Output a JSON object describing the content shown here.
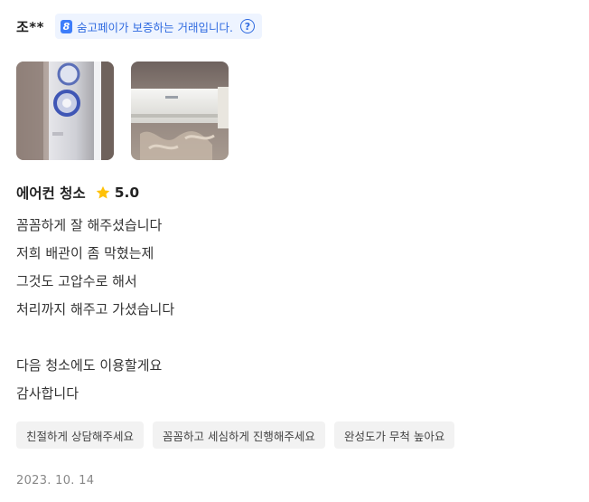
{
  "reviewer": {
    "name": "조**"
  },
  "pay_badge": {
    "logo": "8",
    "text": "숨고페이가 보증하는 거래입니다.",
    "help_icon": "?"
  },
  "photos": [
    {
      "icon": "photo-wall-ac-unit"
    },
    {
      "icon": "photo-split-ac-unit"
    }
  ],
  "service": {
    "name": "에어컨 청소",
    "star_icon": "star-icon",
    "rating": "5.0"
  },
  "review_lines": [
    "꼼꼼하게 잘 해주셨습니다",
    "저희 배관이 좀 막혔는제",
    "그것도 고압수로 해서",
    "처리까지 해주고 가셨습니다",
    "",
    "다음 청소에도 이용할게요",
    "감사합니다"
  ],
  "tags": [
    "친절하게 상담해주세요",
    "꼼꼼하고 세심하게 진행해주세요",
    "완성도가 무척 높아요"
  ],
  "date": "2023. 10. 14",
  "colors": {
    "accent": "#2f6ae0",
    "badge_bg": "#eef4ff",
    "star": "#ffc107",
    "tag_bg": "#f2f2f2"
  }
}
